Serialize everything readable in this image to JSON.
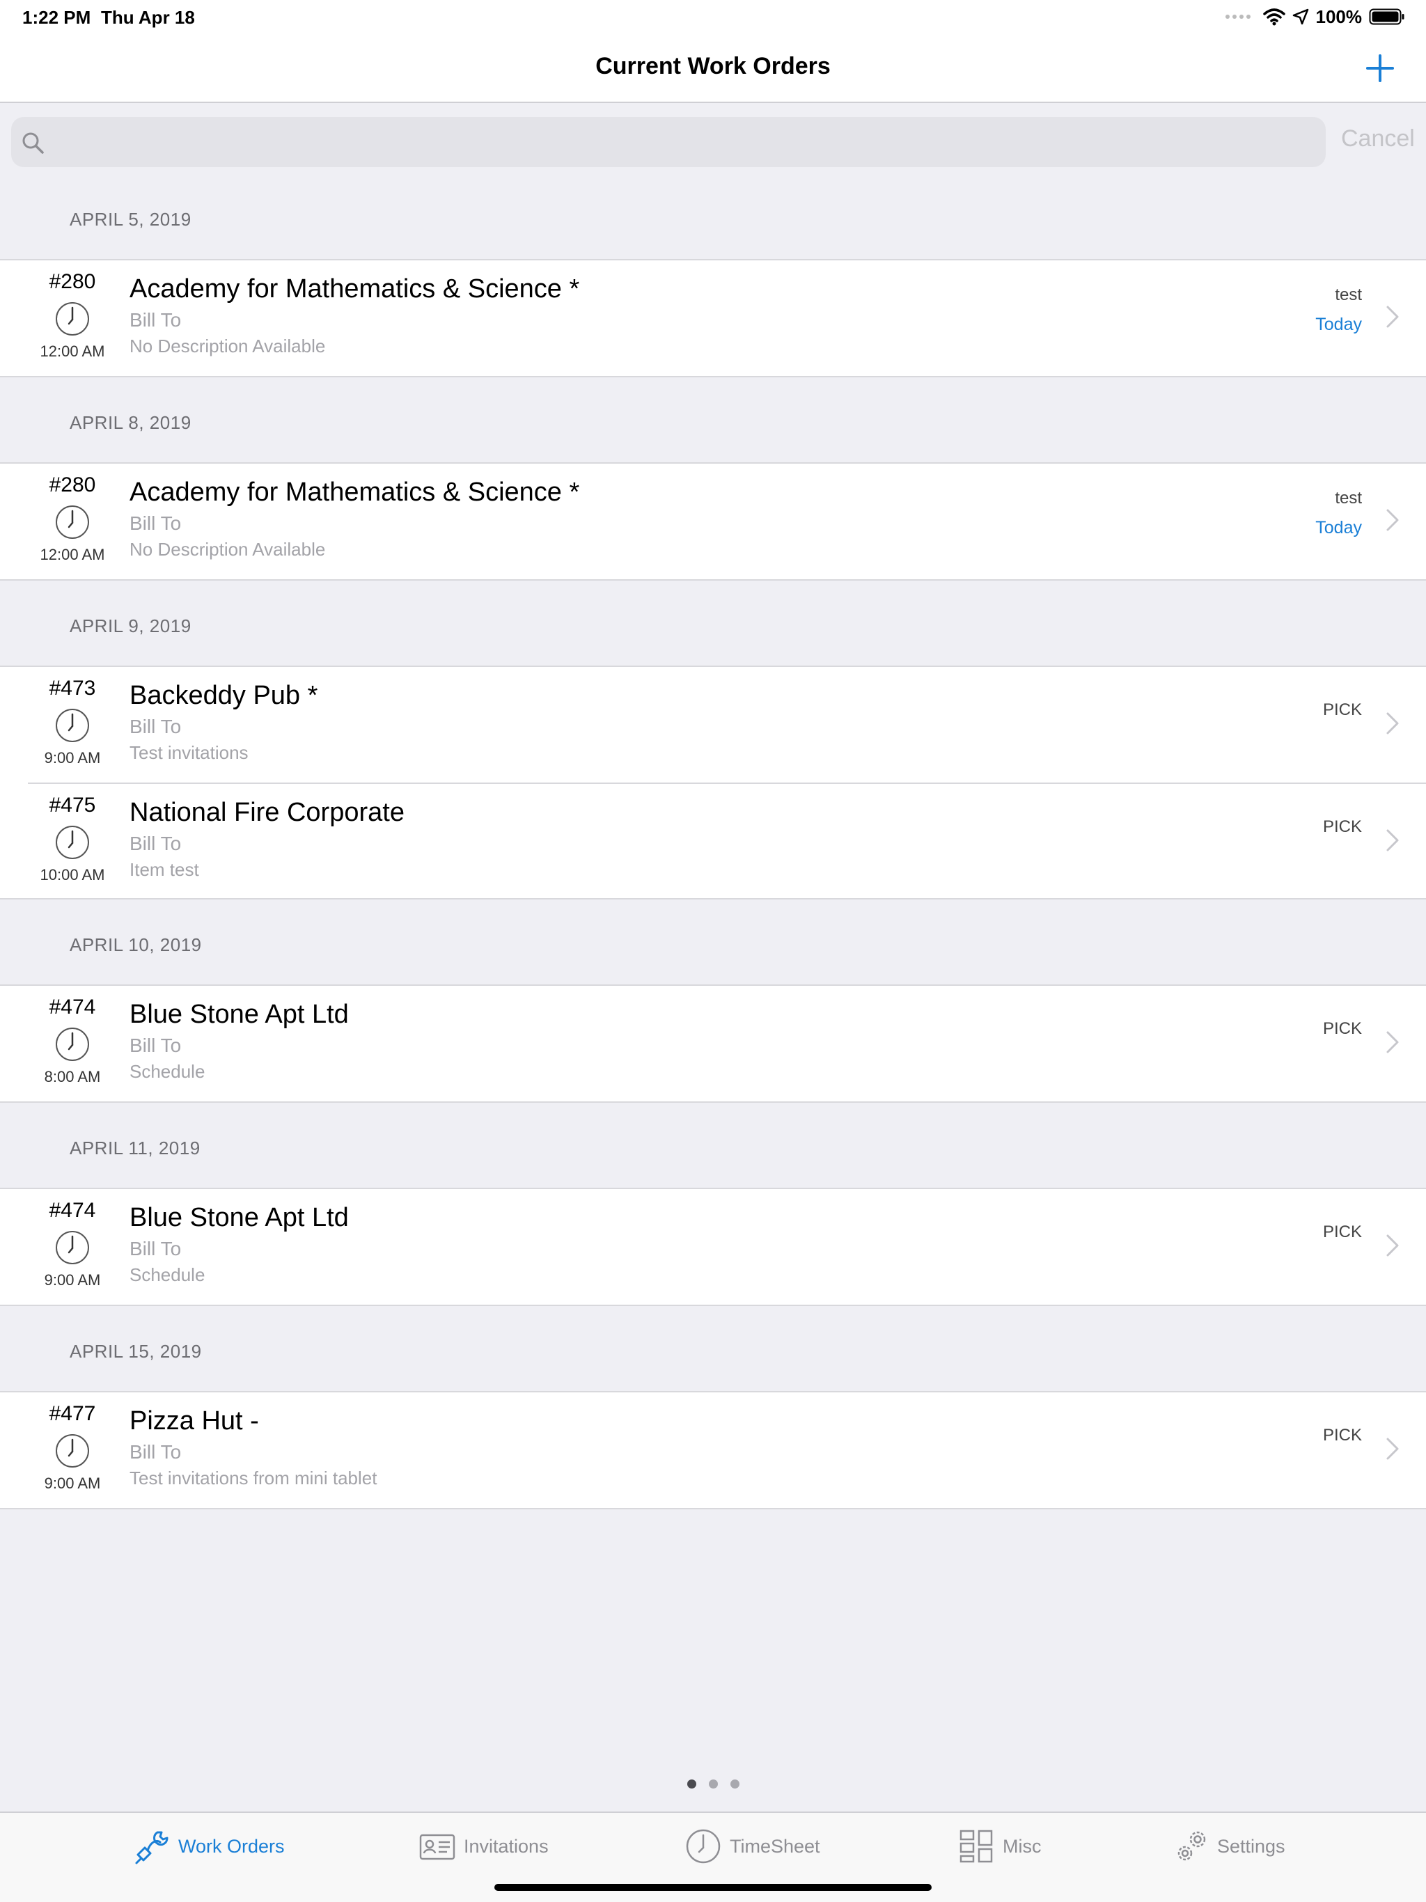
{
  "status_bar": {
    "time": "1:22 PM",
    "date": "Thu Apr 18",
    "battery": "100%"
  },
  "nav": {
    "title": "Current Work Orders",
    "add_icon": "plus-icon",
    "accent_color": "#1a7fd6"
  },
  "search": {
    "value": "",
    "placeholder": "",
    "cancel_label": "Cancel"
  },
  "sections": [
    {
      "header": "APRIL 5, 2019",
      "orders": [
        {
          "number": "#280",
          "time": "12:00 AM",
          "title": "Academy for Mathematics & Science *",
          "bill_to": "Bill To",
          "description": "No Description Available",
          "status": "test",
          "due": "Today"
        }
      ]
    },
    {
      "header": "APRIL 8, 2019",
      "orders": [
        {
          "number": "#280",
          "time": "12:00 AM",
          "title": "Academy for Mathematics & Science *",
          "bill_to": "Bill To",
          "description": "No Description Available",
          "status": "test",
          "due": "Today"
        }
      ]
    },
    {
      "header": "APRIL 9, 2019",
      "orders": [
        {
          "number": "#473",
          "time": "9:00 AM",
          "title": "Backeddy Pub *",
          "bill_to": "Bill To",
          "description": "Test invitations",
          "status": "PICK",
          "due": ""
        },
        {
          "number": "#475",
          "time": "10:00 AM",
          "title": "National Fire Corporate",
          "bill_to": "Bill To",
          "description": "Item test",
          "status": "PICK",
          "due": ""
        }
      ]
    },
    {
      "header": "APRIL 10, 2019",
      "orders": [
        {
          "number": "#474",
          "time": "8:00 AM",
          "title": "Blue Stone Apt Ltd",
          "bill_to": "Bill To",
          "description": "Schedule",
          "status": "PICK",
          "due": ""
        }
      ]
    },
    {
      "header": "APRIL 11, 2019",
      "orders": [
        {
          "number": "#474",
          "time": "9:00 AM",
          "title": "Blue Stone Apt Ltd",
          "bill_to": "Bill To",
          "description": "Schedule",
          "status": "PICK",
          "due": ""
        }
      ]
    },
    {
      "header": "APRIL 15, 2019",
      "orders": [
        {
          "number": "#477",
          "time": "9:00 AM",
          "title": "Pizza Hut -",
          "bill_to": "Bill To",
          "description": "Test invitations from mini tablet",
          "status": "PICK",
          "due": ""
        }
      ]
    }
  ],
  "page_indicator": {
    "pages": 3,
    "current": 1
  },
  "tabs": [
    {
      "label": "Work Orders",
      "icon": "wrench-plug-icon",
      "active": true
    },
    {
      "label": "Invitations",
      "icon": "id-card-icon",
      "active": false
    },
    {
      "label": "TimeSheet",
      "icon": "clock-icon",
      "active": false
    },
    {
      "label": "Misc",
      "icon": "grid-icon",
      "active": false
    },
    {
      "label": "Settings",
      "icon": "gears-icon",
      "active": false
    }
  ]
}
